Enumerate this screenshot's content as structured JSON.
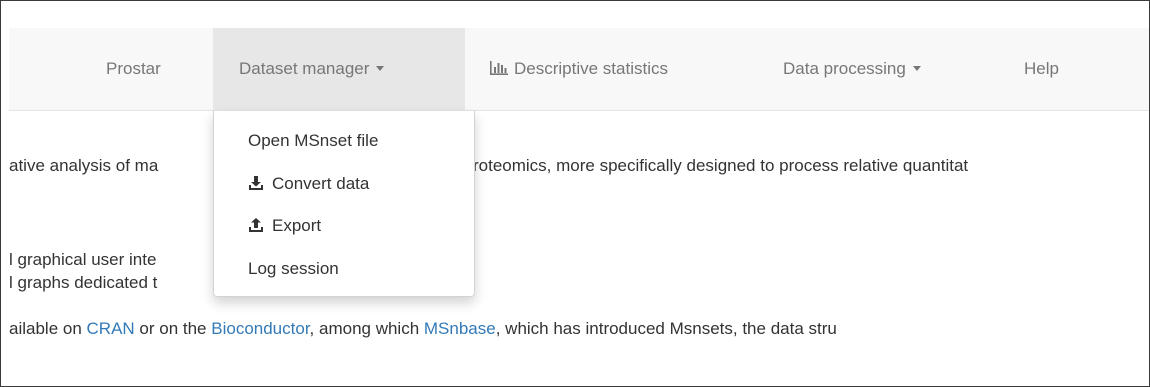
{
  "navbar": {
    "items": [
      {
        "label": "Prostar"
      },
      {
        "label": "Dataset manager"
      },
      {
        "label": "Descriptive statistics",
        "icon": "bar-chart-icon"
      },
      {
        "label": "Data processing"
      },
      {
        "label": "Help"
      }
    ]
  },
  "dropdown": {
    "items": [
      {
        "label": "Open MSnset file"
      },
      {
        "label": "Convert data",
        "icon": "download-icon"
      },
      {
        "label": "Export",
        "icon": "upload-icon"
      },
      {
        "label": "Log session"
      }
    ]
  },
  "content": {
    "line1_left": "ative analysis of ma",
    "line1_right": "roteomics, more specifically designed to process relative quantitat",
    "line2": "l graphical user inte",
    "line3": "l graphs dedicated t",
    "line4_a": "ailable on ",
    "link_cran": "CRAN",
    "line4_b": " or on the ",
    "link_bioconductor": "Bioconductor",
    "line4_c": ", among which ",
    "link_msnbase": "MSnbase",
    "line4_d": ", which has introduced Msnsets, the data stru"
  },
  "colors": {
    "navbar_bg": "#f8f8f8",
    "nav_active_bg": "#e7e7e7",
    "nav_text": "#777777",
    "link": "#337ab7",
    "text": "#333333"
  }
}
